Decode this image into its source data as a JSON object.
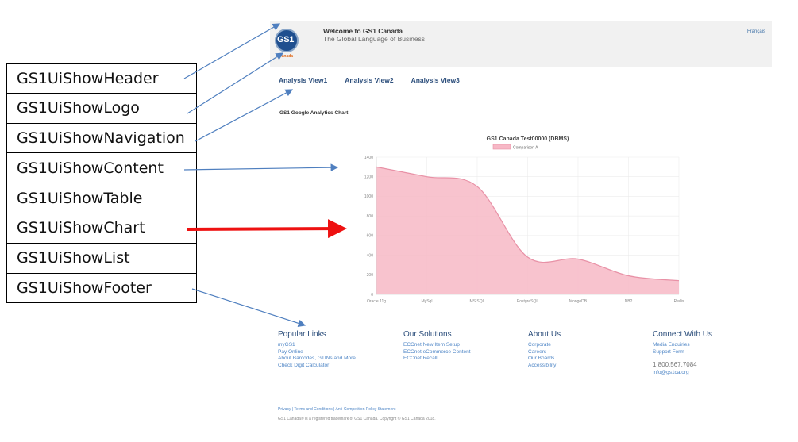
{
  "labels": [
    "GS1UiShowHeader",
    "GS1UiShowLogo",
    "GS1UiShowNavigation",
    "GS1UiShowContent",
    "GS1UiShowTable",
    "GS1UiShowChart",
    "GS1UiShowList",
    "GS1UiShowFooter"
  ],
  "header": {
    "logo_text": "GS1",
    "logo_sub": "Canada",
    "welcome": "Welcome to GS1 Canada",
    "tagline": "The Global Language of Business",
    "language_link": "Français"
  },
  "nav": [
    "Analysis View1",
    "Analysis View2",
    "Analysis View3"
  ],
  "content_title": "GS1 Google Analytics Chart",
  "chart_data": {
    "type": "area",
    "title": "GS1 Canada Test00000 (DBMS)",
    "legend": "Comparison A",
    "categories": [
      "Oracle 11g",
      "MySql",
      "MS SQL",
      "PostgreSQL",
      "MongoDB",
      "DB2",
      "Redis"
    ],
    "series": [
      {
        "name": "Comparison A",
        "values": [
          1300,
          1200,
          1100,
          380,
          360,
          190,
          140
        ]
      }
    ],
    "y_ticks": [
      "0",
      "200",
      "400",
      "600",
      "800",
      "1000",
      "1200",
      "1400"
    ],
    "ylim": [
      0,
      1400
    ],
    "fill_color": "#f7b8c6",
    "line_color": "#e891a6",
    "grid": true,
    "legend_position": "top"
  },
  "footer": {
    "columns": [
      {
        "title": "Popular Links",
        "links": [
          "myGS1",
          "Pay Online",
          "About Barcodes, GTINs and More",
          "Check Digit Calculator"
        ]
      },
      {
        "title": "Our Solutions",
        "links": [
          "ECCnet New Item Setup",
          "ECCnet eCommerce Content",
          "ECCnet Recall"
        ]
      },
      {
        "title": "About Us",
        "links": [
          "Corporate",
          "Careers",
          "Our Boards",
          "Accessibility"
        ]
      },
      {
        "title": "Connect With Us",
        "links": [
          "Media Enquiries",
          "Support Form"
        ],
        "phone": "1.800.567.7084",
        "email": "info@gs1ca.org"
      }
    ],
    "legal_links": "Privacy  |  Terms and Conditions  |  Anti-Competition Policy Statement",
    "legal_note": "GS1 Canada® is a registered trademark of GS1 Canada. Copyright © GS1 Canada 2018."
  },
  "colors": {
    "arrow_blue": "#4f7fbf",
    "arrow_red": "#ee1111",
    "nav_text": "#2d4f7c",
    "link_blue": "#4f86c6"
  }
}
